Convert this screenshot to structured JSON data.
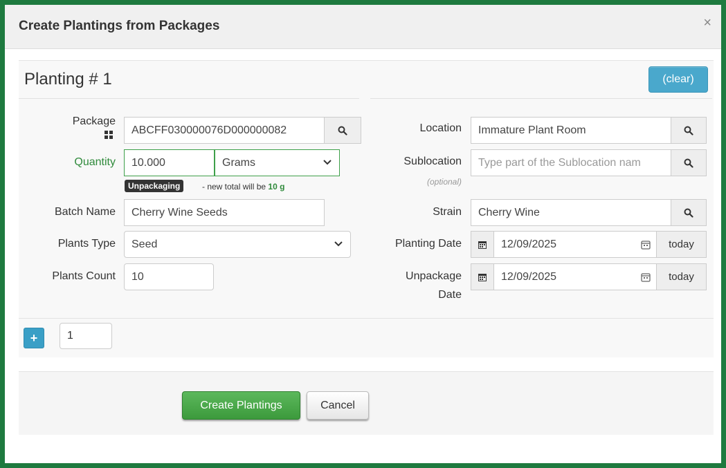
{
  "modal": {
    "title": "Create Plantings from Packages",
    "close_glyph": "×"
  },
  "planting": {
    "title": "Planting # 1",
    "clear_label": "(clear)"
  },
  "fields": {
    "package": {
      "label": "Package",
      "value": "ABCFF030000076D000000082",
      "icon": "grid-icon"
    },
    "quantity": {
      "label": "Quantity",
      "value": "10.000",
      "unit": "Grams",
      "badge": "Unpackaging",
      "hint_prefix": "- new total will be",
      "hint_total": "10 g"
    },
    "batch_name": {
      "label": "Batch Name",
      "value": "Cherry Wine Seeds"
    },
    "plants_type": {
      "label": "Plants Type",
      "value": "Seed"
    },
    "plants_count": {
      "label": "Plants Count",
      "value": "10"
    },
    "location": {
      "label": "Location",
      "value": "Immature Plant Room"
    },
    "sublocation": {
      "label": "Sublocation",
      "optional": "(optional)",
      "placeholder": "Type part of the Sublocation nam"
    },
    "strain": {
      "label": "Strain",
      "value": "Cherry Wine"
    },
    "planting_date": {
      "label": "Planting Date",
      "value": "12/09/2025",
      "today_label": "today"
    },
    "unpackage_date": {
      "label_line1": "Unpackage",
      "label_line2": "Date",
      "value": "12/09/2025",
      "today_label": "today"
    }
  },
  "add_row": {
    "plus_glyph": "+",
    "count": "1"
  },
  "actions": {
    "create_label": "Create Plantings",
    "cancel_label": "Cancel"
  },
  "colors": {
    "frame_border": "#1e7a3f",
    "info_button": "#4aa8cc",
    "success_button": "#5cb85c",
    "accent_green": "#2f8a3b"
  }
}
